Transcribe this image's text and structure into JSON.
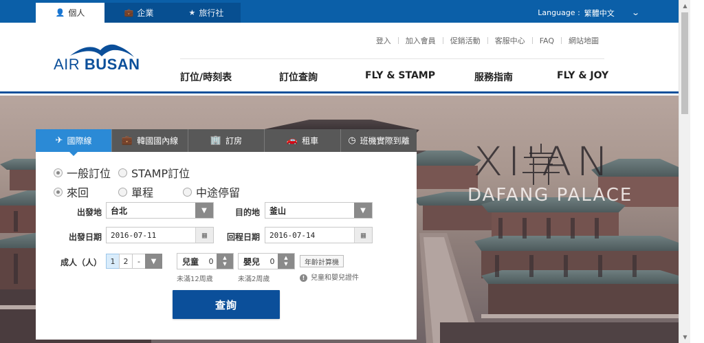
{
  "topbar": {
    "audiences": [
      {
        "label": "個人",
        "icon": "person-icon"
      },
      {
        "label": "企業",
        "icon": "briefcase-icon"
      },
      {
        "label": "旅行社",
        "icon": "star-icon"
      }
    ],
    "language_label": "Language :",
    "language_value": "繁體中文"
  },
  "header": {
    "logo_air": "AIR",
    "logo_busan": "BUSAN",
    "util_links": [
      "登入",
      "加入會員",
      "促銷活動",
      "客服中心",
      "FAQ",
      "網站地圖"
    ],
    "nav": [
      "訂位/時刻表",
      "訂位查詢",
      "FLY & STAMP",
      "服務指南",
      "FLY & JOY"
    ]
  },
  "hero": {
    "title": "XI'AN",
    "subtitle": "DAFANG PALACE"
  },
  "booking": {
    "tabs": [
      {
        "label": "國際線",
        "icon": "plane-icon"
      },
      {
        "label": "韓國國內線",
        "icon": "suitcase-icon"
      },
      {
        "label": "訂房",
        "icon": "building-icon"
      },
      {
        "label": "租車",
        "icon": "car-icon"
      },
      {
        "label": "班機實際到離",
        "icon": "clock-icon"
      }
    ],
    "booking_type": {
      "options": [
        "一般訂位",
        "STAMP訂位"
      ],
      "selected": "一般訂位"
    },
    "trip_type": {
      "options": [
        "來回",
        "單程",
        "中途停留"
      ],
      "selected": "來回"
    },
    "origin_label": "出發地",
    "origin_value": "台北",
    "destination_label": "目的地",
    "destination_value": "釜山",
    "depart_label": "出發日期",
    "depart_value": "2016-07-11",
    "return_label": "回程日期",
    "return_value": "2016-07-14",
    "adult_label": "成人（人）",
    "adult_options": [
      "1",
      "2",
      "-"
    ],
    "adult_selected": "1",
    "child_label": "兒童",
    "child_value": "0",
    "child_hint": "未滿12周歲",
    "infant_label": "嬰兒",
    "infant_value": "0",
    "infant_hint": "未滿2周歲",
    "age_calc_label": "年齡計算機",
    "id_hint": "兒童和嬰兒證件",
    "search_label": "查詢"
  }
}
